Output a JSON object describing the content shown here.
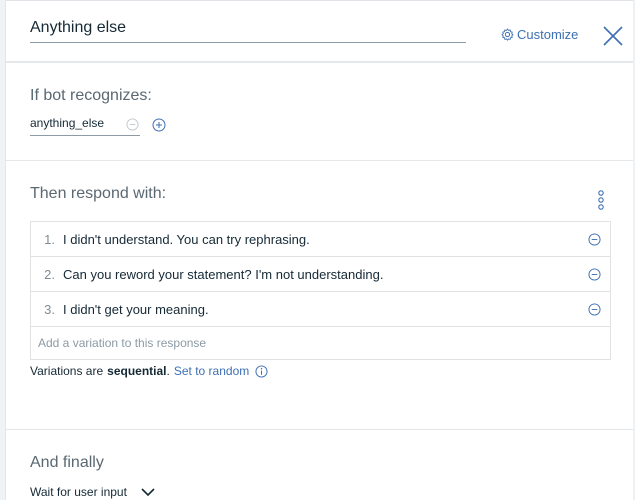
{
  "header": {
    "title_value": "Anything else",
    "customize_label": "Customize"
  },
  "recognizes": {
    "label": "If bot recognizes:",
    "condition_value": "anything_else"
  },
  "respond": {
    "label": "Then respond with:",
    "responses": [
      {
        "num": "1.",
        "text": "I didn't understand. You can try rephrasing."
      },
      {
        "num": "2.",
        "text": "Can you reword your statement? I'm not understanding."
      },
      {
        "num": "3.",
        "text": "I didn't get your meaning."
      }
    ],
    "add_placeholder": "Add a variation to this response",
    "variations_prefix": "Variations are",
    "variations_mode": "sequential",
    "variations_suffix": ".",
    "set_random_label": "Set to random"
  },
  "finally": {
    "label": "And finally",
    "action_value": "Wait for user input"
  },
  "colors": {
    "accent": "#3d70b2",
    "text": "#152935",
    "muted": "#5a6872",
    "border": "#dfe3e6"
  }
}
